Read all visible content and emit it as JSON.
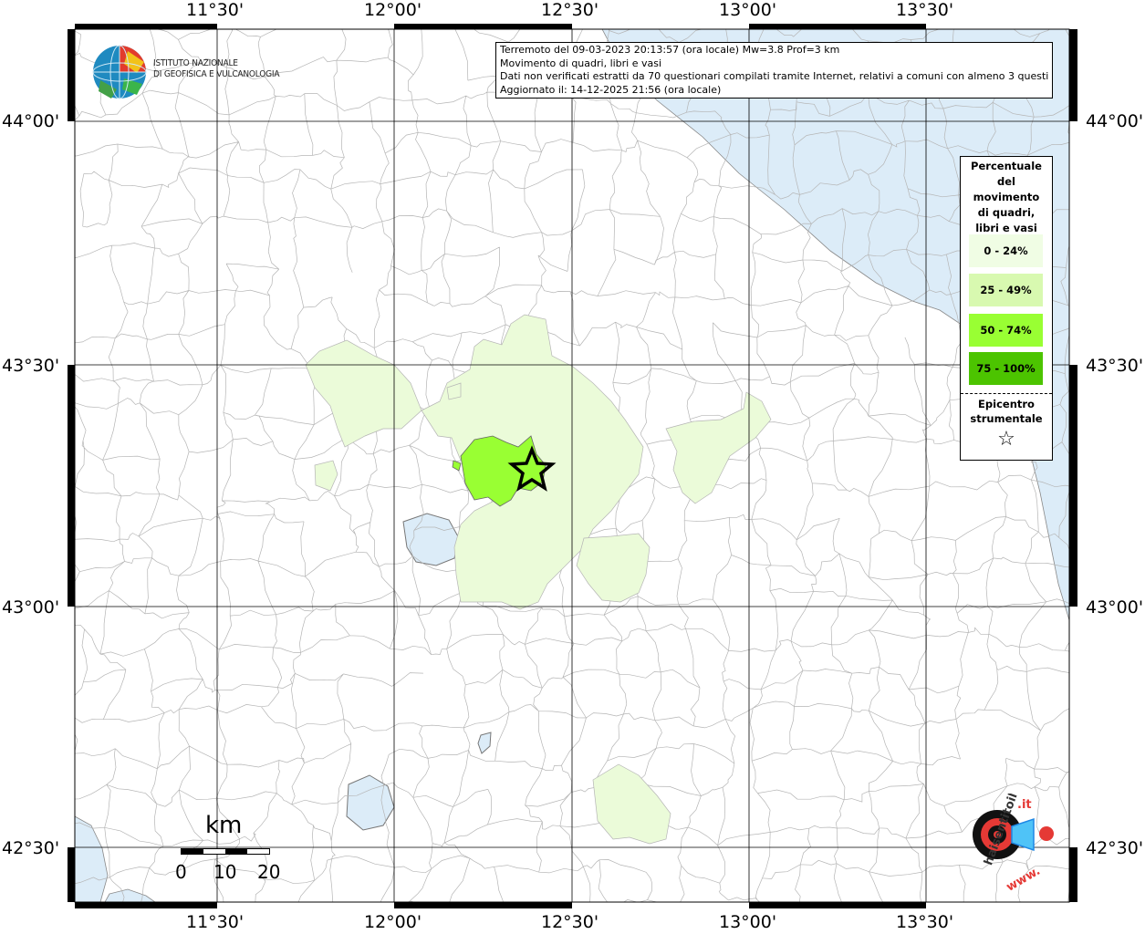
{
  "info": {
    "line1": "Terremoto del 09-03-2023 20:13:57 (ora locale) Mw=3.8 Prof=3 km",
    "line2": "Movimento di quadri, libri e vasi",
    "line3": "Dati non verificati estratti da 70 questionari compilati tramite Internet, relativi a comuni con almeno 3 questionari.",
    "line4": "Aggiornato il: 14-12-2025 21:56 (ora locale)"
  },
  "logo": {
    "line1": "ISTITUTO NAZIONALE",
    "line2": "DI GEOFISICA E VULCANOLOGIA"
  },
  "axes": {
    "lon_ticks": [
      "11°30'",
      "12°00'",
      "12°30'",
      "13°00'",
      "13°30'"
    ],
    "lat_ticks": [
      "44°00'",
      "43°30'",
      "43°00'",
      "42°30'"
    ]
  },
  "legend": {
    "title": [
      "Percentuale",
      "del",
      "movimento",
      "di quadri,",
      "libri e vasi"
    ],
    "items": [
      {
        "label": "0 - 24%",
        "color": "#f0fde4"
      },
      {
        "label": "25 - 49%",
        "color": "#d8f9b0"
      },
      {
        "label": "50 - 74%",
        "color": "#99ff33"
      },
      {
        "label": "75 - 100%",
        "color": "#4cc400"
      }
    ],
    "epicenter_title": [
      "Epicentro",
      "strumentale"
    ],
    "epicenter_symbol": "☆"
  },
  "scale": {
    "unit": "km",
    "labels": [
      "0",
      "10",
      "20"
    ]
  },
  "badge": {
    "text_main": "haisentitoilterremoto",
    "text_suffix": ".it",
    "text_www": "www."
  },
  "colors": {
    "sea": "#dcecf8",
    "lake": "#dcecf8",
    "pale": "#ebfbd9",
    "strong": "#99ff33",
    "frame": "#000000"
  }
}
